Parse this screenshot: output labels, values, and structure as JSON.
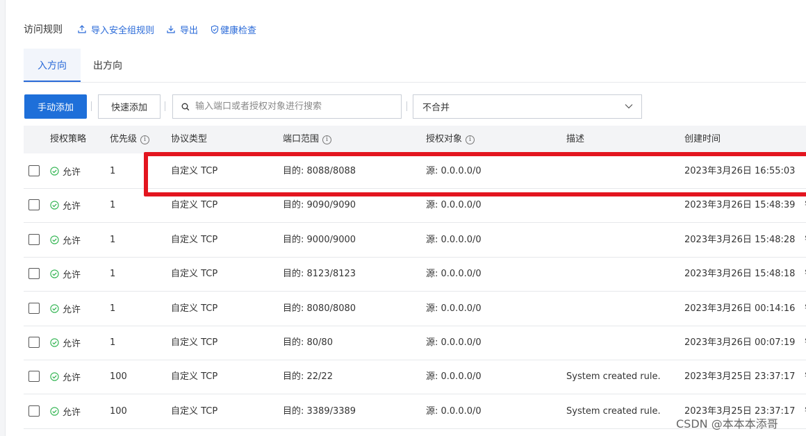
{
  "header": {
    "title": "访问规则",
    "import_label": "导入安全组规则",
    "export_label": "导出",
    "health_label": "健康检查"
  },
  "tabs": [
    {
      "label": "入方向",
      "active": true
    },
    {
      "label": "出方向",
      "active": false
    }
  ],
  "toolbar": {
    "manual_add_label": "手动添加",
    "quick_add_label": "快速添加",
    "search_placeholder": "输入端口或者授权对象进行搜索",
    "merge_select_value": "不合并"
  },
  "table": {
    "columns": [
      "授权策略",
      "优先级",
      "协议类型",
      "端口范围",
      "授权对象",
      "描述",
      "创建时间"
    ],
    "rows": [
      {
        "policy": "允许",
        "priority": "1",
        "protocol": "自定义 TCP",
        "port": "目的: 8088/8088",
        "target": "源: 0.0.0.0/0",
        "desc": "",
        "created": "2023年3月26日 16:55:03",
        "extra": ""
      },
      {
        "policy": "允许",
        "priority": "1",
        "protocol": "自定义 TCP",
        "port": "目的: 9090/9090",
        "target": "源: 0.0.0.0/0",
        "desc": "",
        "created": "2023年3月26日 15:48:39",
        "extra": "钅"
      },
      {
        "policy": "允许",
        "priority": "1",
        "protocol": "自定义 TCP",
        "port": "目的: 9000/9000",
        "target": "源: 0.0.0.0/0",
        "desc": "",
        "created": "2023年3月26日 15:48:28",
        "extra": "钅"
      },
      {
        "policy": "允许",
        "priority": "1",
        "protocol": "自定义 TCP",
        "port": "目的: 8123/8123",
        "target": "源: 0.0.0.0/0",
        "desc": "",
        "created": "2023年3月26日 15:48:18",
        "extra": "钅"
      },
      {
        "policy": "允许",
        "priority": "1",
        "protocol": "自定义 TCP",
        "port": "目的: 8080/8080",
        "target": "源: 0.0.0.0/0",
        "desc": "",
        "created": "2023年3月26日 00:14:16",
        "extra": "钅"
      },
      {
        "policy": "允许",
        "priority": "1",
        "protocol": "自定义 TCP",
        "port": "目的: 80/80",
        "target": "源: 0.0.0.0/0",
        "desc": "",
        "created": "2023年3月26日 00:07:19",
        "extra": "钅"
      },
      {
        "policy": "允许",
        "priority": "100",
        "protocol": "自定义 TCP",
        "port": "目的: 22/22",
        "target": "源: 0.0.0.0/0",
        "desc": "System created rule.",
        "created": "2023年3月25日 23:37:17",
        "extra": "钅"
      },
      {
        "policy": "允许",
        "priority": "100",
        "protocol": "自定义 TCP",
        "port": "目的: 3389/3389",
        "target": "源: 0.0.0.0/0",
        "desc": "System created rule.",
        "created": "2023年3月25日 23:37:17",
        "extra": "钅"
      }
    ]
  },
  "watermark": "CSDN @本本本添哥",
  "colors": {
    "accent": "#1e6fd9",
    "link": "#2a6ad8",
    "allow": "#2bb24c",
    "highlight": "#e3151f"
  },
  "icons": {
    "import": "upload-icon",
    "export": "download-icon",
    "health": "shield-check-icon",
    "search": "search-icon",
    "select": "chevron-down-icon",
    "allow": "check-circle-icon",
    "info": "info-icon"
  }
}
